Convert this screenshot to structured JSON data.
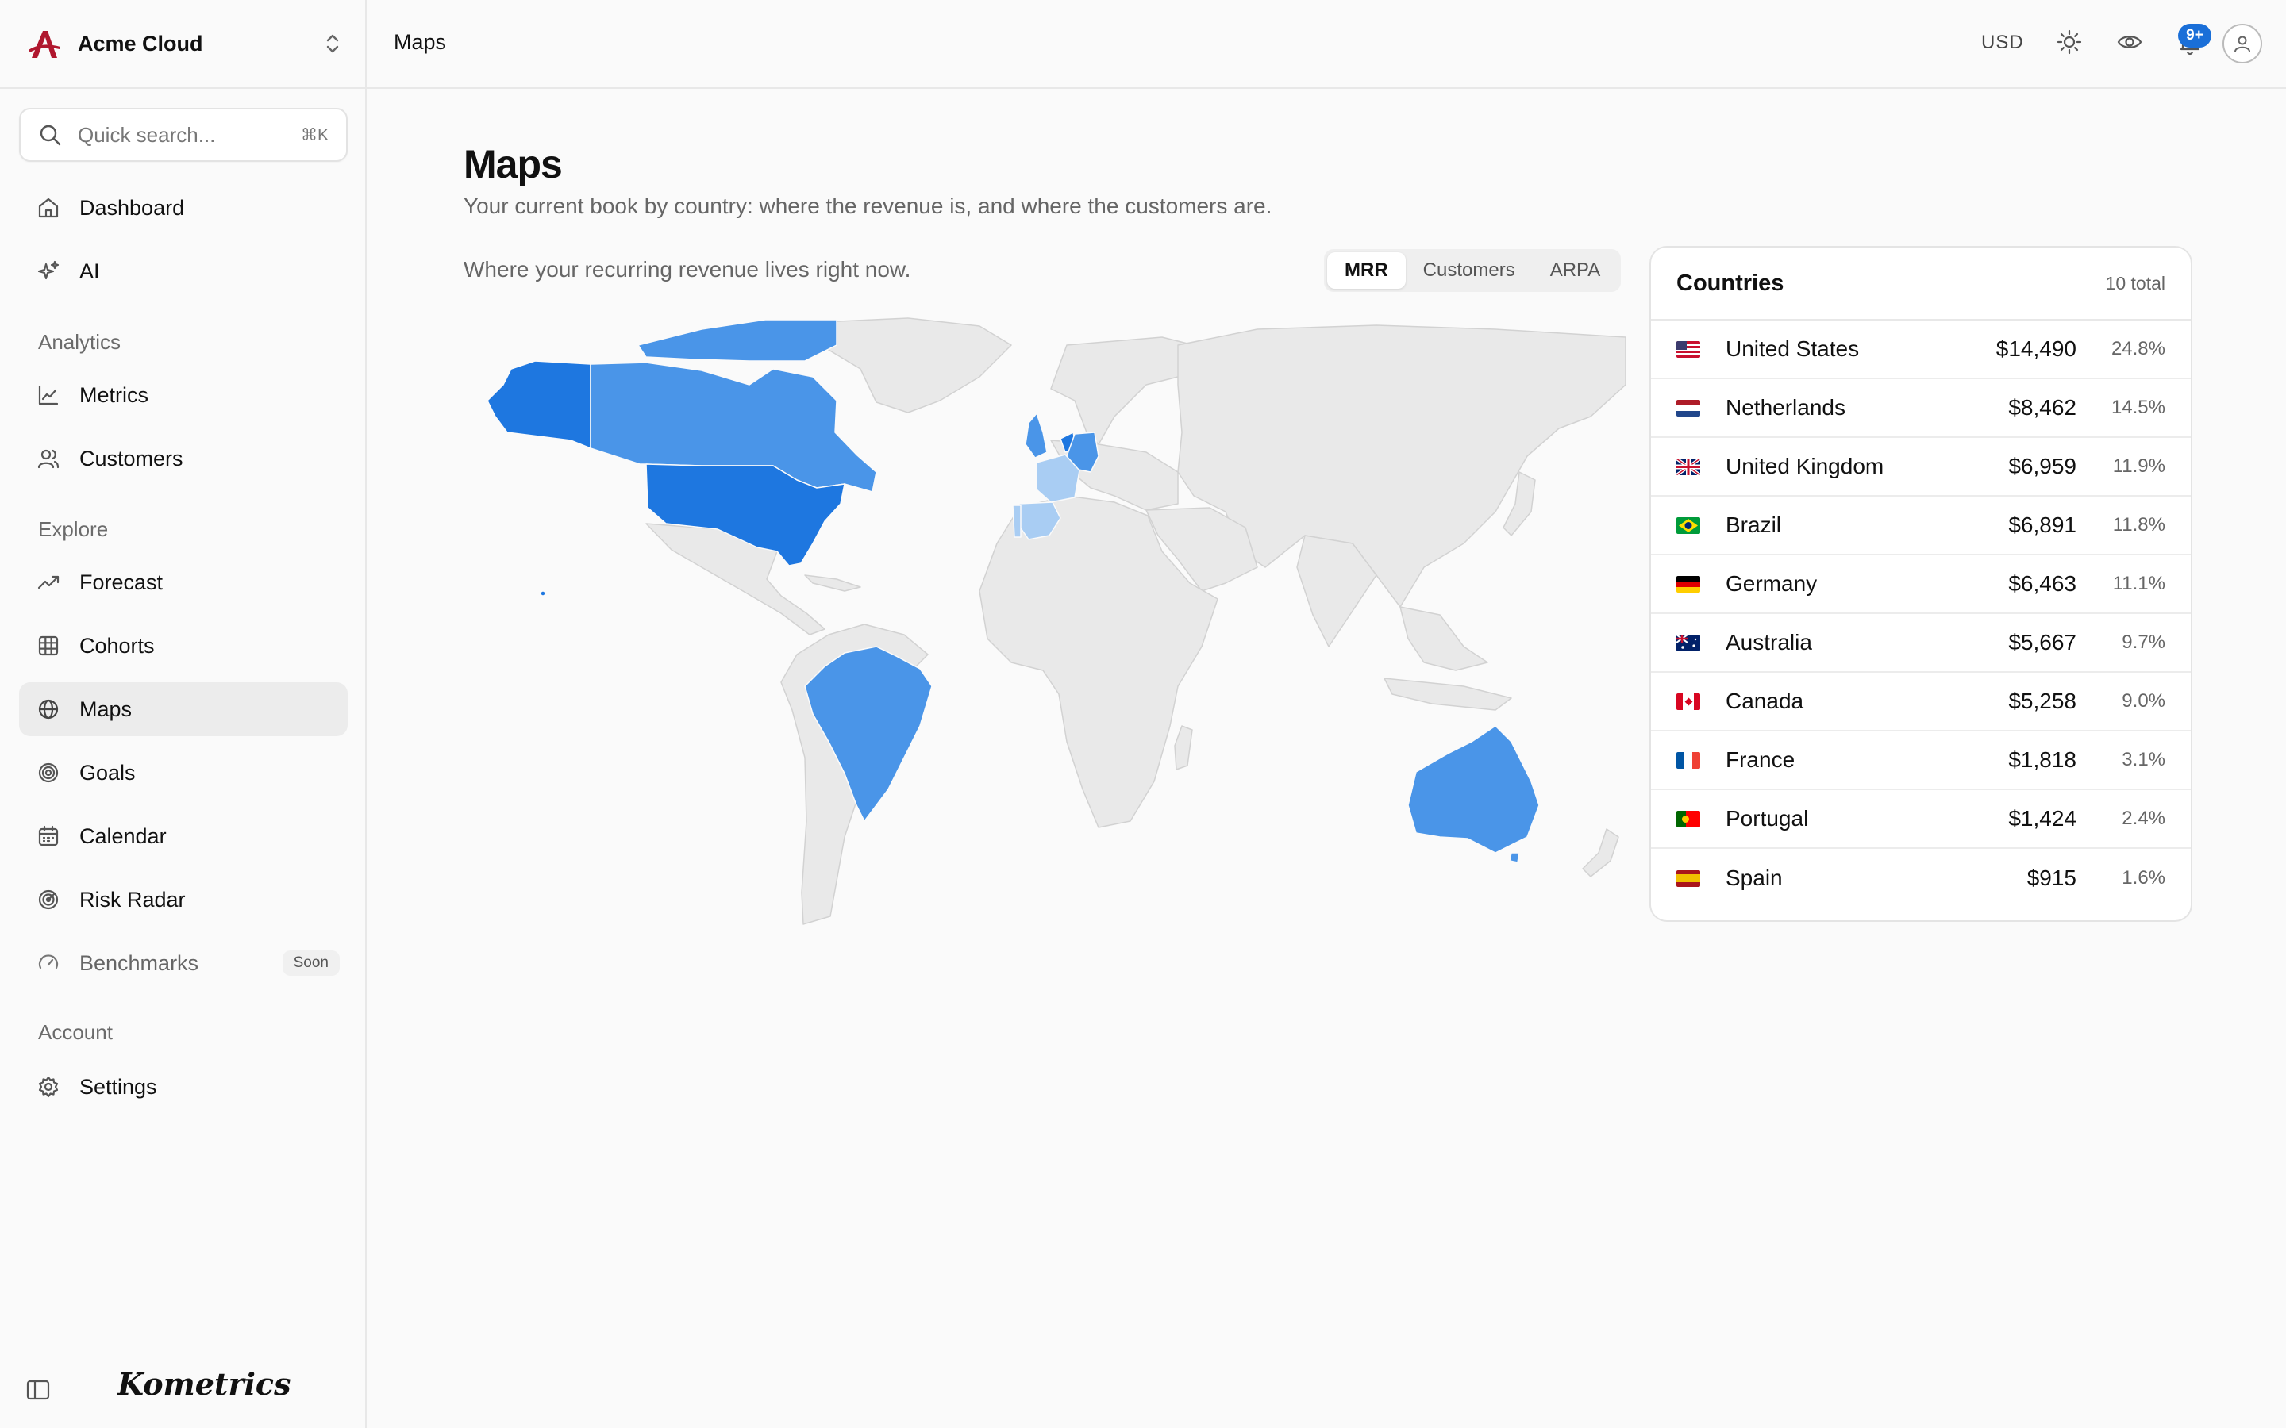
{
  "workspace": {
    "name": "Acme Cloud"
  },
  "search": {
    "placeholder": "Quick search...",
    "shortcut": "⌘K"
  },
  "nav": {
    "top": [
      {
        "label": "Dashboard",
        "icon": "home-icon"
      },
      {
        "label": "AI",
        "icon": "sparkles-icon"
      }
    ],
    "analytics_label": "Analytics",
    "analytics": [
      {
        "label": "Metrics",
        "icon": "line-chart-icon"
      },
      {
        "label": "Customers",
        "icon": "users-icon"
      }
    ],
    "explore_label": "Explore",
    "explore": [
      {
        "label": "Forecast",
        "icon": "trending-up-icon"
      },
      {
        "label": "Cohorts",
        "icon": "grid-icon"
      },
      {
        "label": "Maps",
        "icon": "globe-icon",
        "active": true
      },
      {
        "label": "Goals",
        "icon": "target-icon"
      },
      {
        "label": "Calendar",
        "icon": "calendar-icon"
      },
      {
        "label": "Risk Radar",
        "icon": "radar-icon"
      },
      {
        "label": "Benchmarks",
        "icon": "gauge-icon",
        "badge": "Soon"
      }
    ],
    "account_label": "Account",
    "account": [
      {
        "label": "Settings",
        "icon": "gear-icon"
      }
    ]
  },
  "brand": "Kometrics",
  "topbar": {
    "title": "Maps",
    "currency": "USD",
    "notifications": "9+"
  },
  "page": {
    "title": "Maps",
    "subtitle": "Your current book by country: where the revenue is, and where the customers are.",
    "lede": "Where your recurring revenue lives right now."
  },
  "metric_tabs": [
    {
      "label": "MRR",
      "active": true
    },
    {
      "label": "Customers",
      "active": false
    },
    {
      "label": "ARPA",
      "active": false
    }
  ],
  "countries_card": {
    "title": "Countries",
    "total": "10 total",
    "rows": [
      {
        "country": "United States",
        "mrr": "$14,490",
        "share": "24.8%"
      },
      {
        "country": "Netherlands",
        "mrr": "$8,462",
        "share": "14.5%"
      },
      {
        "country": "United Kingdom",
        "mrr": "$6,959",
        "share": "11.9%"
      },
      {
        "country": "Brazil",
        "mrr": "$6,891",
        "share": "11.8%"
      },
      {
        "country": "Germany",
        "mrr": "$6,463",
        "share": "11.1%"
      },
      {
        "country": "Australia",
        "mrr": "$5,667",
        "share": "9.7%"
      },
      {
        "country": "Canada",
        "mrr": "$5,258",
        "share": "9.0%"
      },
      {
        "country": "France",
        "mrr": "$1,818",
        "share": "3.1%"
      },
      {
        "country": "Portugal",
        "mrr": "$1,424",
        "share": "2.4%"
      },
      {
        "country": "Spain",
        "mrr": "$915",
        "share": "1.6%"
      }
    ]
  },
  "colors": {
    "accent": "#1a6fd8",
    "map_high": "#1e77e0",
    "map_mid": "#4a95e8",
    "map_low": "#a9cdf3",
    "map_base": "#e9e9e9"
  }
}
